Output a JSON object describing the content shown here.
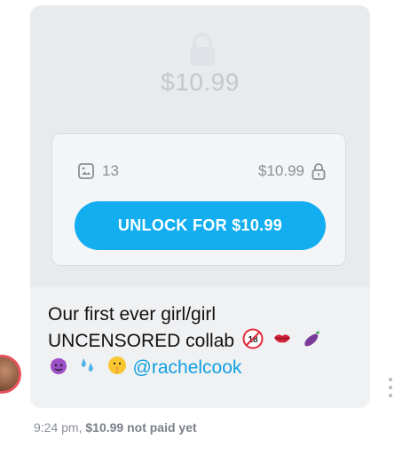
{
  "post": {
    "price_large": "$10.99",
    "media_count": "13",
    "price_small": "$10.99",
    "unlock_label": "UNLOCK FOR $10.99",
    "message_line1": "Our first ever girl/girl",
    "message_line2": "UNCENSORED collab",
    "mention": "@rachelcook",
    "emoji_line2": [
      "no-under-18-icon",
      "kiss-lips-icon",
      "eggplant-icon"
    ],
    "emoji_line3": [
      "smiling-devil-icon",
      "sweat-droplets-icon",
      "shushing-face-icon"
    ]
  },
  "meta": {
    "time": "9:24 pm,",
    "price": "$10.99",
    "status": "not paid yet"
  },
  "colors": {
    "accent": "#12aef0",
    "bubble_bg": "#f0f1f3",
    "locked_bg": "#e9eaed",
    "mention": "#12a0e0",
    "avatar_ring": "#e7535b"
  }
}
